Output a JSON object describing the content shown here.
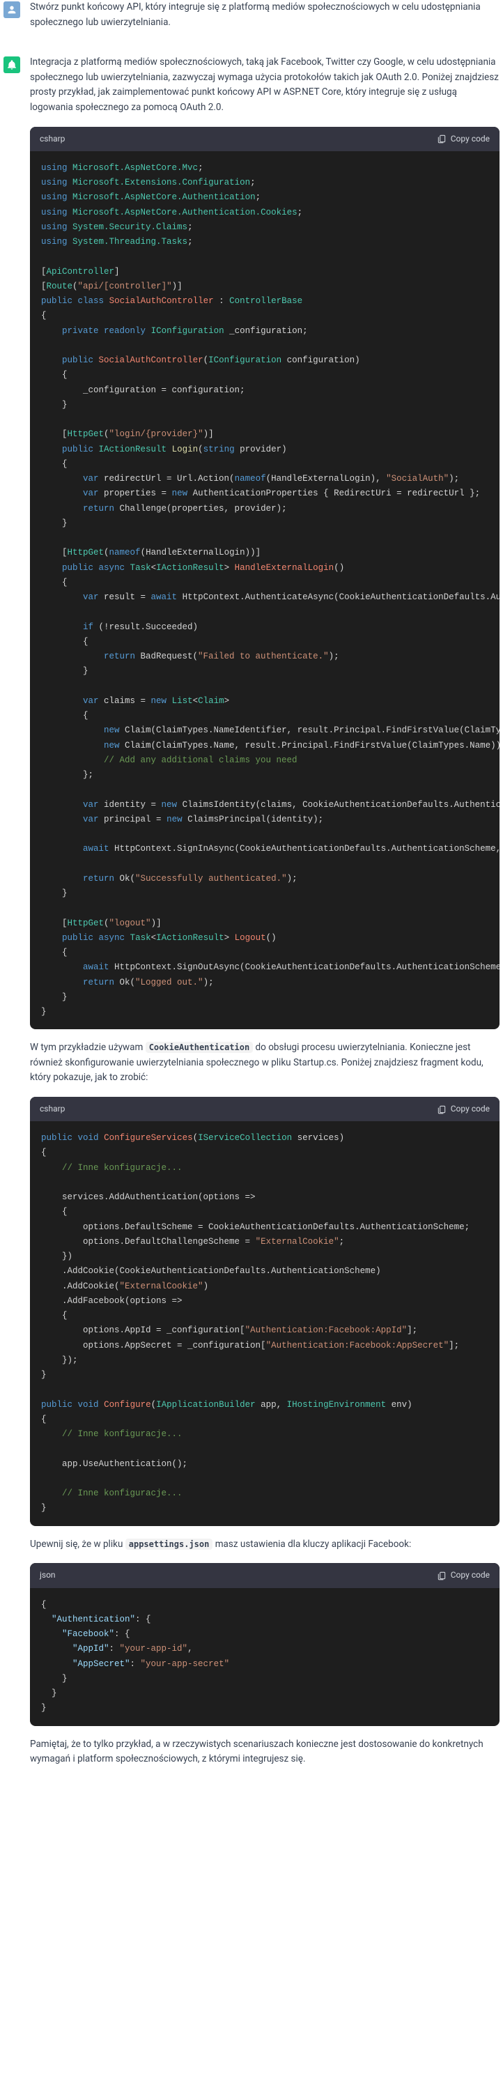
{
  "user": {
    "prompt": "Stwórz punkt końcowy API, który integruje się z platformą mediów społecznościowych w celu udostępniania społecznego lub uwierzytelniania."
  },
  "assistant": {
    "intro": "Integracja z platformą mediów społecznościowych, taką jak Facebook, Twitter czy Google, w celu udostępniania społecznego lub uwierzytelniania, zazwyczaj wymaga użycia protokołów takich jak OAuth 2.0. Poniżej znajdziesz prosty przykład, jak zaimplementować punkt końcowy API w ASP.NET Core, który integruje się z usługą logowania społecznego za pomocą OAuth 2.0.",
    "middle1_a": "W tym przykładzie używam ",
    "middle1_code": "CookieAuthentication",
    "middle1_b": " do obsługi procesu uwierzytelniania. Konieczne jest również skonfigurowanie uwierzytelniania społecznego w pliku Startup.cs. Poniżej znajdziesz fragment kodu, który pokazuje, jak to zrobić:",
    "middle2_a": "Upewnij się, że w pliku ",
    "middle2_code": "appsettings.json",
    "middle2_b": " masz ustawienia dla kluczy aplikacji Facebook:",
    "outro": "Pamiętaj, że to tylko przykład, a w rzeczywistych scenariuszach konieczne jest dostosowanie do konkretnych wymagań i platform społecznościowych, z którymi integrujesz się."
  },
  "code": {
    "lang_csharp": "csharp",
    "lang_json": "json",
    "copy_label": "Copy code"
  },
  "chart_data": null
}
